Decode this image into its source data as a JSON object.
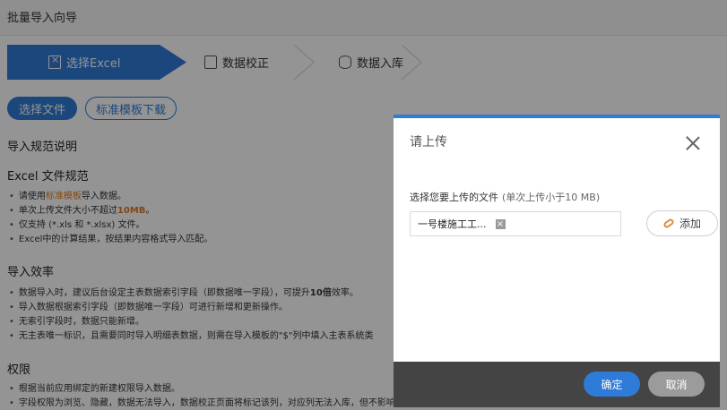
{
  "page": {
    "title": "批量导入向导"
  },
  "steps": [
    {
      "label": "选择Excel",
      "icon": "excel-file-icon",
      "active": true
    },
    {
      "label": "数据校正",
      "icon": "check-screen-icon",
      "active": false
    },
    {
      "label": "数据入库",
      "icon": "database-icon",
      "active": false
    }
  ],
  "actions": {
    "choose": "选择文件",
    "template": "标准模板下载"
  },
  "spec": {
    "heading": "导入规范说明",
    "excel": {
      "title": "Excel 文件规范",
      "r1_pre": "请使用",
      "r1_link": "标准模板",
      "r1_post": "导入数据。",
      "r2_pre": "单次上传文件大小不超过",
      "r2_val": "10MB",
      "r2_post": "。",
      "r3": "仅支持 (*.xls 和 *.xlsx) 文件。",
      "r4": "Excel中的计算结果，按结果内容格式导入匹配。"
    },
    "efficiency": {
      "title": "导入效率",
      "r1_pre": "数据导入时，建议后台设定主表数据索引字段（即数据唯一字段），可提升",
      "r1_bold": "10倍",
      "r1_post": "效率。",
      "r2": "导入数据根据索引字段（即数据唯一字段）可进行新增和更新操作。",
      "r3": "无索引字段时，数据只能新增。",
      "r4": "无主表唯一标识，且需要同时导入明细表数据，则需在导入模板的\"$\"列中填入主表系统类"
    },
    "permission": {
      "title": "权限",
      "r1": "根据当前应用绑定的新建权限导入数据。",
      "r2": "字段权限为浏览、隐藏，数据无法导入，数据校正页面将标记该列，对应列无法入库，但不影响其他列入库。"
    }
  },
  "dialog": {
    "title": "请上传",
    "upload_label": "选择您要上传的文件",
    "upload_hint": "(单次上传小于10 MB)",
    "file_name": "一号楼施工工...",
    "add_label": "添加",
    "ok_label": "确定",
    "cancel_label": "取消"
  },
  "colors": {
    "accent": "#2f7bd8",
    "link": "#e07a1f",
    "overlay": "rgba(0,0,0,0.42)"
  }
}
